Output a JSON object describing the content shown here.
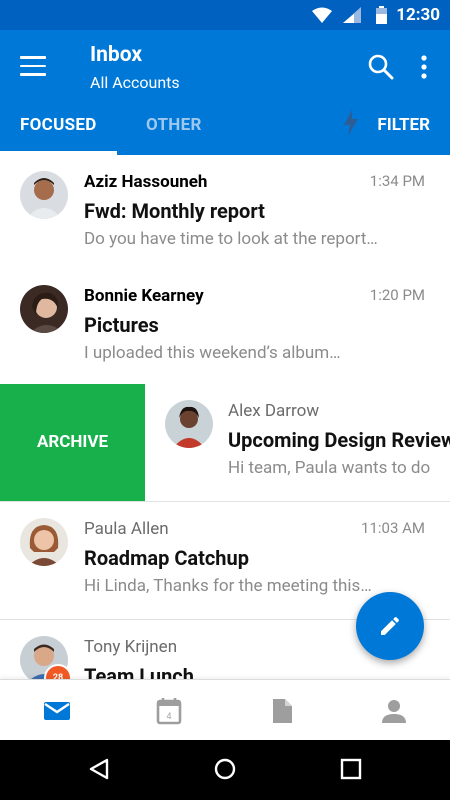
{
  "status_bar": {
    "time": "12:30"
  },
  "header": {
    "title": "Inbox",
    "subtitle": "All Accounts",
    "tabs": [
      {
        "label": "FOCUSED",
        "active": true
      },
      {
        "label": "OTHER",
        "active": false
      }
    ],
    "filter_label": "FILTER"
  },
  "emails": [
    {
      "sender": "Aziz Hassouneh",
      "subject": "Fwd: Monthly report",
      "preview": "Do you have time to look at the report…",
      "time": "1:34 PM",
      "unread": true
    },
    {
      "sender": "Bonnie Kearney",
      "subject": "Pictures",
      "preview": "I uploaded this weekend’s album…",
      "time": "1:20 PM",
      "unread": true
    },
    {
      "sender": "Alex Darrow",
      "subject": "Upcoming Design Review",
      "preview": "Hi team, Paula wants to do",
      "time": "",
      "unread": false
    },
    {
      "sender": "Paula Allen",
      "subject": "Roadmap Catchup",
      "preview": "Hi Linda, Thanks for the meeting this…",
      "time": "11:03 AM",
      "unread": false
    },
    {
      "sender": "Tony Krijnen",
      "subject": "Team Lunch",
      "preview": "",
      "time": "",
      "unread": false
    }
  ],
  "swipe_action": {
    "label": "ARCHIVE",
    "color": "#18b04a"
  },
  "calendar_badge": "28",
  "bottom_nav": {
    "items": [
      {
        "icon": "mail-icon",
        "active": true
      },
      {
        "icon": "calendar-icon",
        "day": "4",
        "active": false
      },
      {
        "icon": "file-icon",
        "active": false
      },
      {
        "icon": "person-icon",
        "active": false
      }
    ]
  },
  "colors": {
    "accent": "#0078d7",
    "status_bar": "#0061c0",
    "archive": "#18b04a"
  }
}
